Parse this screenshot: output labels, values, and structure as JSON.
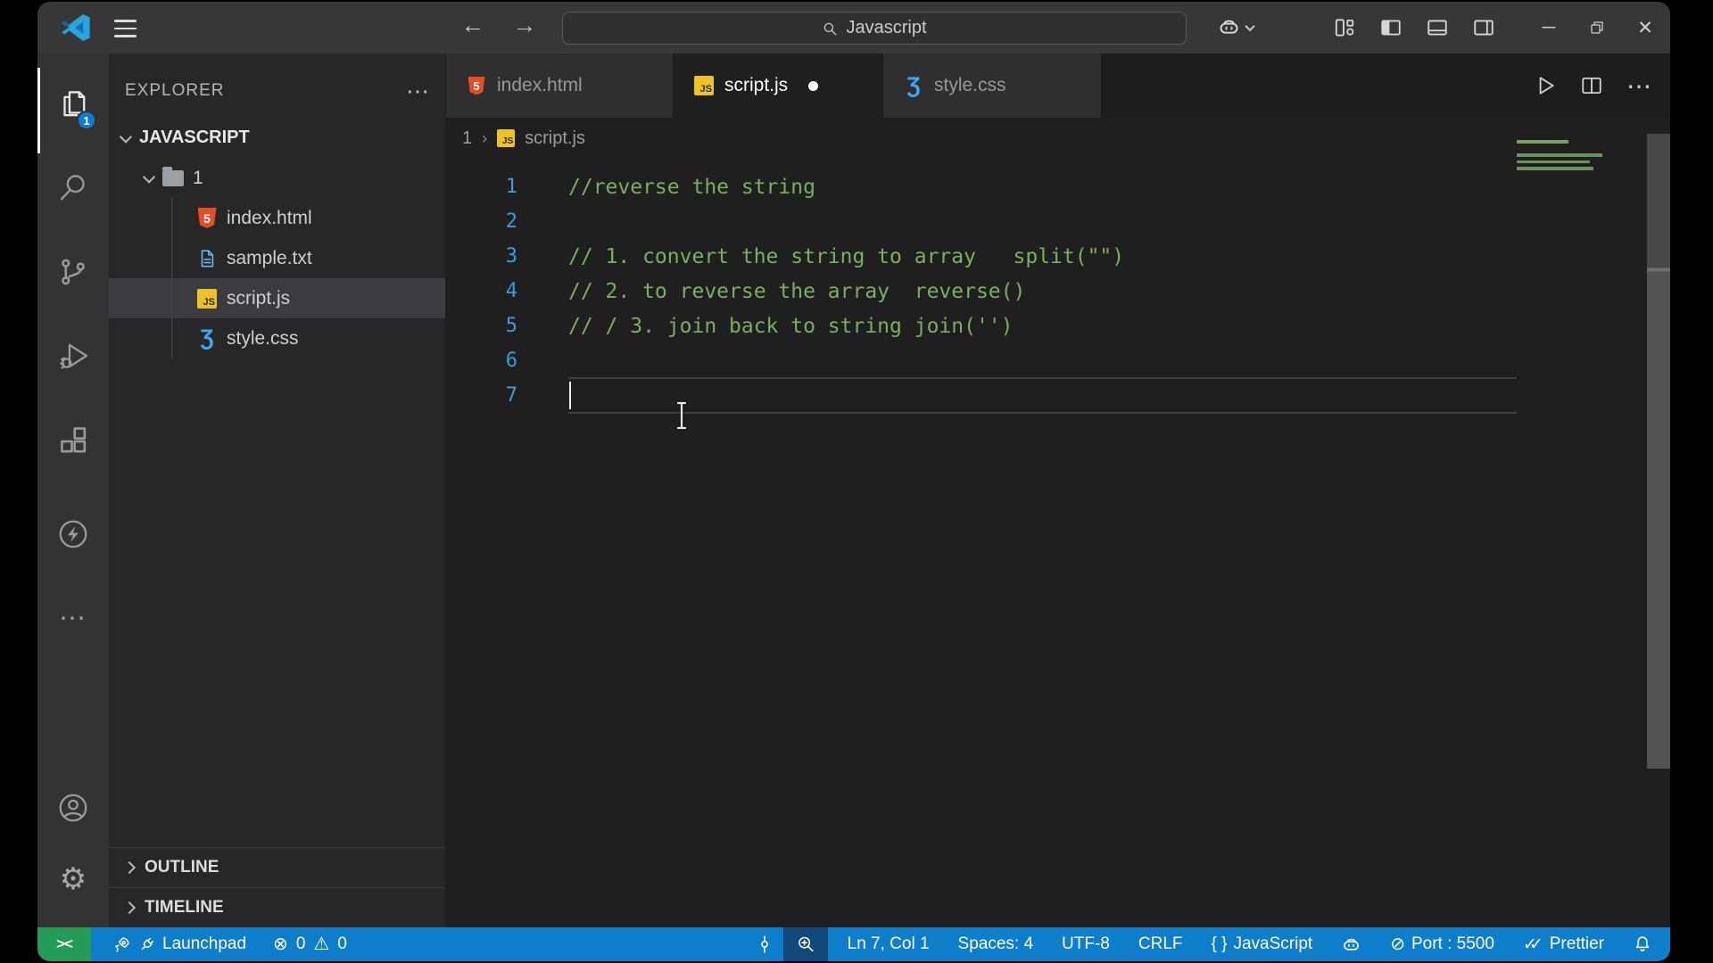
{
  "title_bar": {
    "search_value": "Javascript",
    "back_icon": "←",
    "forward_icon": "→",
    "minimize_icon": "─",
    "close_icon": "✕"
  },
  "activity_bar": {
    "files_badge": "1",
    "more_icon": "⋯",
    "gear_icon": "⚙"
  },
  "explorer": {
    "header": "EXPLORER",
    "header_more_icon": "⋯",
    "workspace": "JAVASCRIPT",
    "folder": "1",
    "files": [
      {
        "name": "index.html"
      },
      {
        "name": "sample.txt"
      },
      {
        "name": "script.js"
      },
      {
        "name": "style.css"
      }
    ],
    "sections": [
      {
        "label": "OUTLINE"
      },
      {
        "label": "TIMELINE"
      }
    ]
  },
  "tabs": [
    {
      "label": "index.html"
    },
    {
      "label": "script.js"
    },
    {
      "label": "style.css"
    }
  ],
  "editor_actions": {
    "more_icon": "⋯"
  },
  "breadcrumb": {
    "folder": "1",
    "sep": "›",
    "file": "script.js"
  },
  "editor": {
    "lines": [
      {
        "num": "1",
        "text": "//reverse the string"
      },
      {
        "num": "2",
        "text": ""
      },
      {
        "num": "3",
        "text": "// 1. convert the string to array   split(\"\")"
      },
      {
        "num": "4",
        "text": "// 2. to reverse the array  reverse()"
      },
      {
        "num": "5",
        "text": "// / 3. join back to string join('')"
      },
      {
        "num": "6",
        "text": ""
      },
      {
        "num": "7",
        "text": ""
      }
    ]
  },
  "icons": {
    "html_glyph": "5",
    "js_glyph": "JS",
    "css_glyph": "Ʒ",
    "error_glyph": "⊗",
    "warning_glyph": "⚠",
    "slash_circle_glyph": "⊘",
    "double_check_glyph": "✓✓",
    "remote_glyph": "><"
  },
  "status_bar": {
    "launchpad": "Launchpad",
    "errors": "0",
    "warnings": "0",
    "cursor_position": "Ln 7, Col 1",
    "indentation": "Spaces: 4",
    "encoding": "UTF-8",
    "eol": "CRLF",
    "language_braces": "{ }",
    "language": "JavaScript",
    "port": "Port : 5500",
    "formatter": "Prettier"
  },
  "colors": {
    "status_blue": "#0e7ecb",
    "remote_green": "#249b56",
    "comment_green": "#7aae61",
    "line_number_blue": "#3f9bd8",
    "html_orange": "#e44d26",
    "js_yellow": "#ecc327",
    "css_blue": "#42a5f5"
  }
}
